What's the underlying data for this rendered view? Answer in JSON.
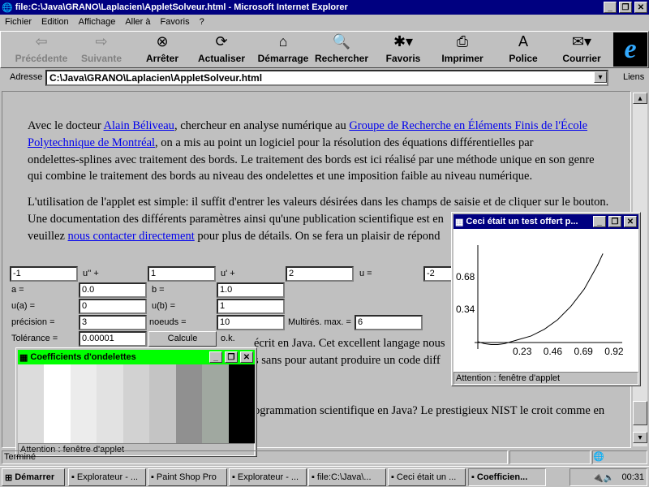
{
  "window": {
    "title": "file:C:\\Java\\GRANO\\Laplacien\\AppletSolveur.html - Microsoft Internet Explorer"
  },
  "menu": [
    "Fichier",
    "Edition",
    "Affichage",
    "Aller à",
    "Favoris",
    "?"
  ],
  "toolbar": [
    {
      "label": "Précédente",
      "icon": "back-arrow-icon",
      "glyph": "⇦",
      "disabled": true
    },
    {
      "label": "Suivante",
      "icon": "forward-arrow-icon",
      "glyph": "⇨",
      "disabled": true
    },
    {
      "label": "Arrêter",
      "icon": "stop-icon",
      "glyph": "⊗"
    },
    {
      "label": "Actualiser",
      "icon": "refresh-icon",
      "glyph": "⟳"
    },
    {
      "label": "Démarrage",
      "icon": "home-icon",
      "glyph": "⌂"
    },
    {
      "label": "Rechercher",
      "icon": "search-icon",
      "glyph": "🔍"
    },
    {
      "label": "Favoris",
      "icon": "favorites-icon",
      "glyph": "✱▾"
    },
    {
      "label": "Imprimer",
      "icon": "printer-icon",
      "glyph": "⎙"
    },
    {
      "label": "Police",
      "icon": "font-icon",
      "glyph": "A"
    },
    {
      "label": "Courrier",
      "icon": "mail-icon",
      "glyph": "✉▾"
    }
  ],
  "address": {
    "label": "Adresse",
    "value": "C:\\Java\\GRANO\\Laplacien\\AppletSolveur.html",
    "links": "Liens"
  },
  "content": {
    "p1": [
      "Avec le docteur ",
      "Alain Béliveau",
      ", chercheur en analyse numérique au ",
      "Groupe de Recherche en Éléments Finis de l'École ",
      "Polytechnique de Montréal",
      ", on a mis au point un logiciel pour la résolution des équations différentielles par",
      "ondelettes-splines avec traitement des bords. Le traitement des bords est ici réalisé par une méthode unique en son genre",
      "qui combine le traitement des bords au niveau des ondelettes et une imposition faible au niveau numérique."
    ],
    "p2": [
      "L'utilisation de l'applet est simple: il suffit d'entrer les valeurs désirées dans les champs de saisie et de cliquer sur le bouton.",
      "Une documentation des différents paramètres ainsi qu'une publication scientifique est en",
      "veuillez ",
      "nous contacter directement",
      " pour plus de détails. On se fera un plaisir de répond"
    ],
    "p3": [
      "écrit en Java. Cet excellent langage nous",
      "s sans pour autant produire un code diff"
    ],
    "p4": "ogrammation scientifique en Java? Le prestigieux NIST le croit comme en"
  },
  "applet": {
    "coef_u2": "-1",
    "lbl_u2": "u'' +",
    "coef_u1": "1",
    "lbl_u1": "u' +",
    "coef_u0": "2",
    "lbl_u0": "u  =",
    "rhs": "-2",
    "a_lbl": "a =",
    "a": "0.0",
    "b_lbl": "b =",
    "b": "1.0",
    "ua_lbl": "u(a) =",
    "ua": "0",
    "ub_lbl": "u(b) =",
    "ub": "1",
    "prec_lbl": "précision =",
    "prec": "3",
    "noeuds_lbl": "noeuds =",
    "noeuds": "10",
    "multi_lbl": "Multirés. max. =",
    "multi": "6",
    "tol_lbl": "Tolérance =",
    "tol": "0.00001",
    "calc": "Calcule",
    "status": "o.k."
  },
  "graph_window": {
    "title": "Ceci était un test offert p...",
    "footer": "Attention : fenêtre d'applet",
    "chart_data": {
      "type": "line",
      "x": [
        0,
        0.05,
        0.1,
        0.15,
        0.2,
        0.25,
        0.3,
        0.4,
        0.5,
        0.6,
        0.7,
        0.8,
        0.9,
        0.94
      ],
      "y": [
        0,
        -0.02,
        -0.03,
        -0.03,
        -0.02,
        0,
        0.02,
        0.06,
        0.13,
        0.23,
        0.37,
        0.55,
        0.8,
        0.92
      ],
      "xticks": [
        "0.23",
        "0.46",
        "0.69",
        "0.92"
      ],
      "yticks": [
        "0.34",
        "0.68"
      ]
    }
  },
  "coef_window": {
    "title": "Coefficients d'ondelettes",
    "footer": "Attention : fenêtre d'applet",
    "shades": [
      "#dcdcdc",
      "#ffffff",
      "#ececec",
      "#e2e2e2",
      "#d2d2d2",
      "#c4c4c4",
      "#909090",
      "#a0a8a0",
      "#000000"
    ]
  },
  "statusbar": {
    "text": "Terminé"
  },
  "taskbar": {
    "start": "Démarrer",
    "items": [
      "Explorateur - ...",
      "Paint Shop Pro",
      "Explorateur - ...",
      "file:C:\\Java\\...",
      "Ceci était un ...",
      "Coefficien..."
    ],
    "clock": "00:31"
  }
}
